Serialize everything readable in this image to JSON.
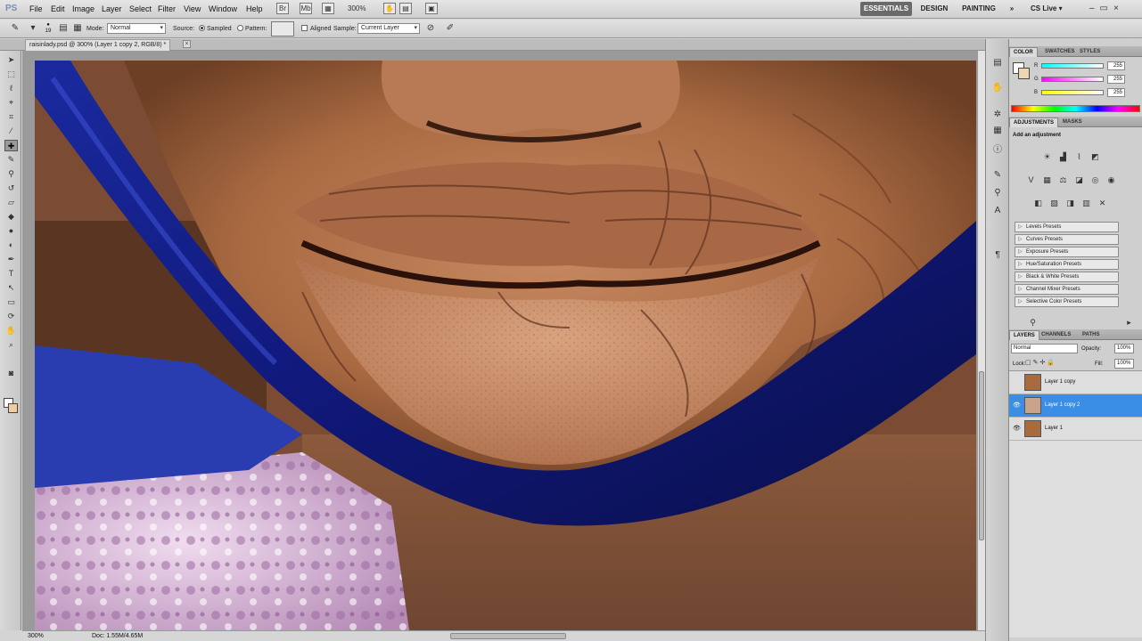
{
  "menubar": {
    "logo": "PS",
    "items": [
      "File",
      "Edit",
      "Image",
      "Layer",
      "Select",
      "Filter",
      "View",
      "Window",
      "Help"
    ],
    "zoom": "300%",
    "workspaces": [
      "ESSENTIALS",
      "DESIGN",
      "PAINTING"
    ],
    "workspace_more": "»",
    "cs_live": "CS Live ▾"
  },
  "options": {
    "brush_size": "19",
    "mode_label": "Mode:",
    "mode_value": "Normal",
    "source_label": "Source:",
    "sampled_label": "Sampled",
    "pattern_label": "Pattern:",
    "aligned_label": "Aligned",
    "sample_label": "Sample:",
    "sample_value": "Current Layer"
  },
  "document": {
    "tab_title": "raisinlady.psd @ 300% (Layer 1 copy 2, RGB/8) *",
    "close": "×"
  },
  "status": {
    "zoom": "300%",
    "doc_size": "Doc: 1.55M/4.65M"
  },
  "color_panel": {
    "tabs": [
      "COLOR",
      "SWATCHES",
      "STYLES"
    ],
    "channels": [
      {
        "label": "R",
        "value": "255"
      },
      {
        "label": "G",
        "value": "255"
      },
      {
        "label": "B",
        "value": "255"
      }
    ]
  },
  "adjustments_panel": {
    "tabs": [
      "ADJUSTMENTS",
      "MASKS"
    ],
    "title": "Add an adjustment",
    "presets": [
      "Levels Presets",
      "Curves Presets",
      "Exposure Presets",
      "Hue/Saturation Presets",
      "Black & White Presets",
      "Channel Mixer Presets",
      "Selective Color Presets"
    ]
  },
  "layers_panel": {
    "tabs": [
      "LAYERS",
      "CHANNELS",
      "PATHS"
    ],
    "blend_mode": "Normal",
    "opacity_label": "Opacity:",
    "opacity_value": "100%",
    "lock_label": "Lock:",
    "fill_label": "Fill:",
    "fill_value": "100%",
    "layers": [
      {
        "name": "Layer 1 copy",
        "visible": false,
        "selected": false
      },
      {
        "name": "Layer 1 copy 2",
        "visible": true,
        "selected": true
      },
      {
        "name": "Layer 1",
        "visible": true,
        "selected": false
      }
    ]
  },
  "colors": {
    "foreground": "#ffffff",
    "background": "#f3cba0",
    "selection": "#3a8ee6",
    "essentials_bg": "#6a6a6a"
  }
}
